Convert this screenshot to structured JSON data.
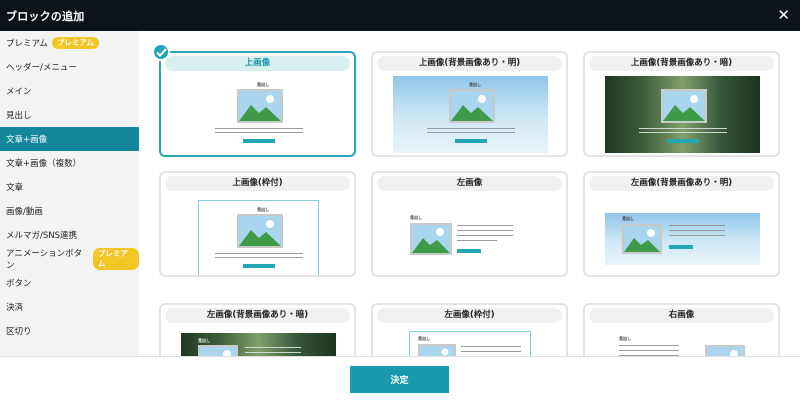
{
  "header": {
    "title": "ブロックの追加"
  },
  "sidebar": {
    "items": [
      {
        "label": "プレミアム",
        "badge": "プレミアム"
      },
      {
        "label": "ヘッダー/メニュー"
      },
      {
        "label": "メイン"
      },
      {
        "label": "見出し"
      },
      {
        "label": "文章+画像",
        "active": true
      },
      {
        "label": "文章+画像（複数）"
      },
      {
        "label": "文章"
      },
      {
        "label": "画像/動画"
      },
      {
        "label": "メルマガ/SNS連携"
      },
      {
        "label": "アニメーションボタン",
        "badge": "プレミアム"
      },
      {
        "label": "ボタン"
      },
      {
        "label": "決済"
      },
      {
        "label": "区切り"
      }
    ]
  },
  "cards": [
    {
      "label": "上画像",
      "selected": true
    },
    {
      "label": "上画像(背景画像あり・明)"
    },
    {
      "label": "上画像(背景画像あり・暗)"
    },
    {
      "label": "上画像(枠付)"
    },
    {
      "label": "左画像"
    },
    {
      "label": "左画像(背景画像あり・明)"
    },
    {
      "label": "左画像(背景画像あり・暗)"
    },
    {
      "label": "左画像(枠付)"
    },
    {
      "label": "右画像"
    }
  ],
  "thumb": {
    "heading": "見出し"
  },
  "footer": {
    "decide_label": "決定"
  },
  "colors": {
    "accent": "#1a9aac",
    "header_bg": "#0b1418",
    "badge": "#f2c624"
  }
}
